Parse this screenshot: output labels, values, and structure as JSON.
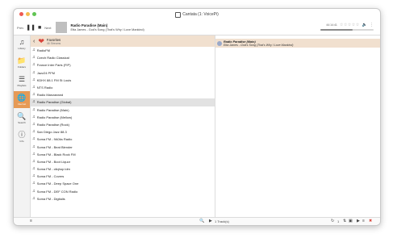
{
  "window": {
    "title": "Cantata (1: VoicePi)"
  },
  "toolbar": {
    "prev_label": "Prev",
    "play_icon": "pause-icon",
    "next_label": "Next",
    "now_playing": {
      "title": "Radio Paradise (Main)",
      "artist": "Etta James - God's Song (That's Why I Love Mankind)"
    },
    "time": "44:14:41",
    "rating_stars": "☆☆☆☆☆",
    "progress_fraction": 0.6
  },
  "sidebar": {
    "items": [
      {
        "label": "Library",
        "icon": "music-library-icon"
      },
      {
        "label": "Folders",
        "icon": "folder-icon"
      },
      {
        "label": "Playlists",
        "icon": "playlist-icon"
      },
      {
        "label": "Internet",
        "icon": "globe-icon"
      },
      {
        "label": "Search",
        "icon": "search-icon"
      },
      {
        "label": "Info",
        "icon": "info-icon"
      }
    ]
  },
  "list": {
    "header_title": "Favorites",
    "header_subtitle": "46 Streams",
    "items": [
      "RadioFM",
      "Czech Radio Classical",
      "France Inter Paris (FIP)",
      "Jazz24 PFM",
      "KDHX 88.1 FM St Louis",
      "NTS Radio",
      "Radio Manzaeand",
      "Radio Paradise (Global)",
      "Radio Paradise (Main)",
      "Radio Paradise (Mellow)",
      "Radio Paradise (Rock)",
      "San Diego Jazz 88.3",
      "Soma FM - 9A0ks Radio",
      "Soma FM - Beat Blender",
      "Soma FM - Black Rock FM",
      "Soma FM - Boot Liquor",
      "Soma FM - cliqhop idm",
      "Soma FM - Covers",
      "Soma FM - Deep Space One",
      "Soma FM - DEF CON Radio",
      "Soma FM - Digitalis"
    ],
    "selected_index": 7
  },
  "playqueue": {
    "current": {
      "title": "Radio Paradise (Main)",
      "artist": "Etta James - God's Song (That's Why I Love Mankind)"
    }
  },
  "bottom": {
    "track_count": "1 Track(s)",
    "count": "1"
  }
}
